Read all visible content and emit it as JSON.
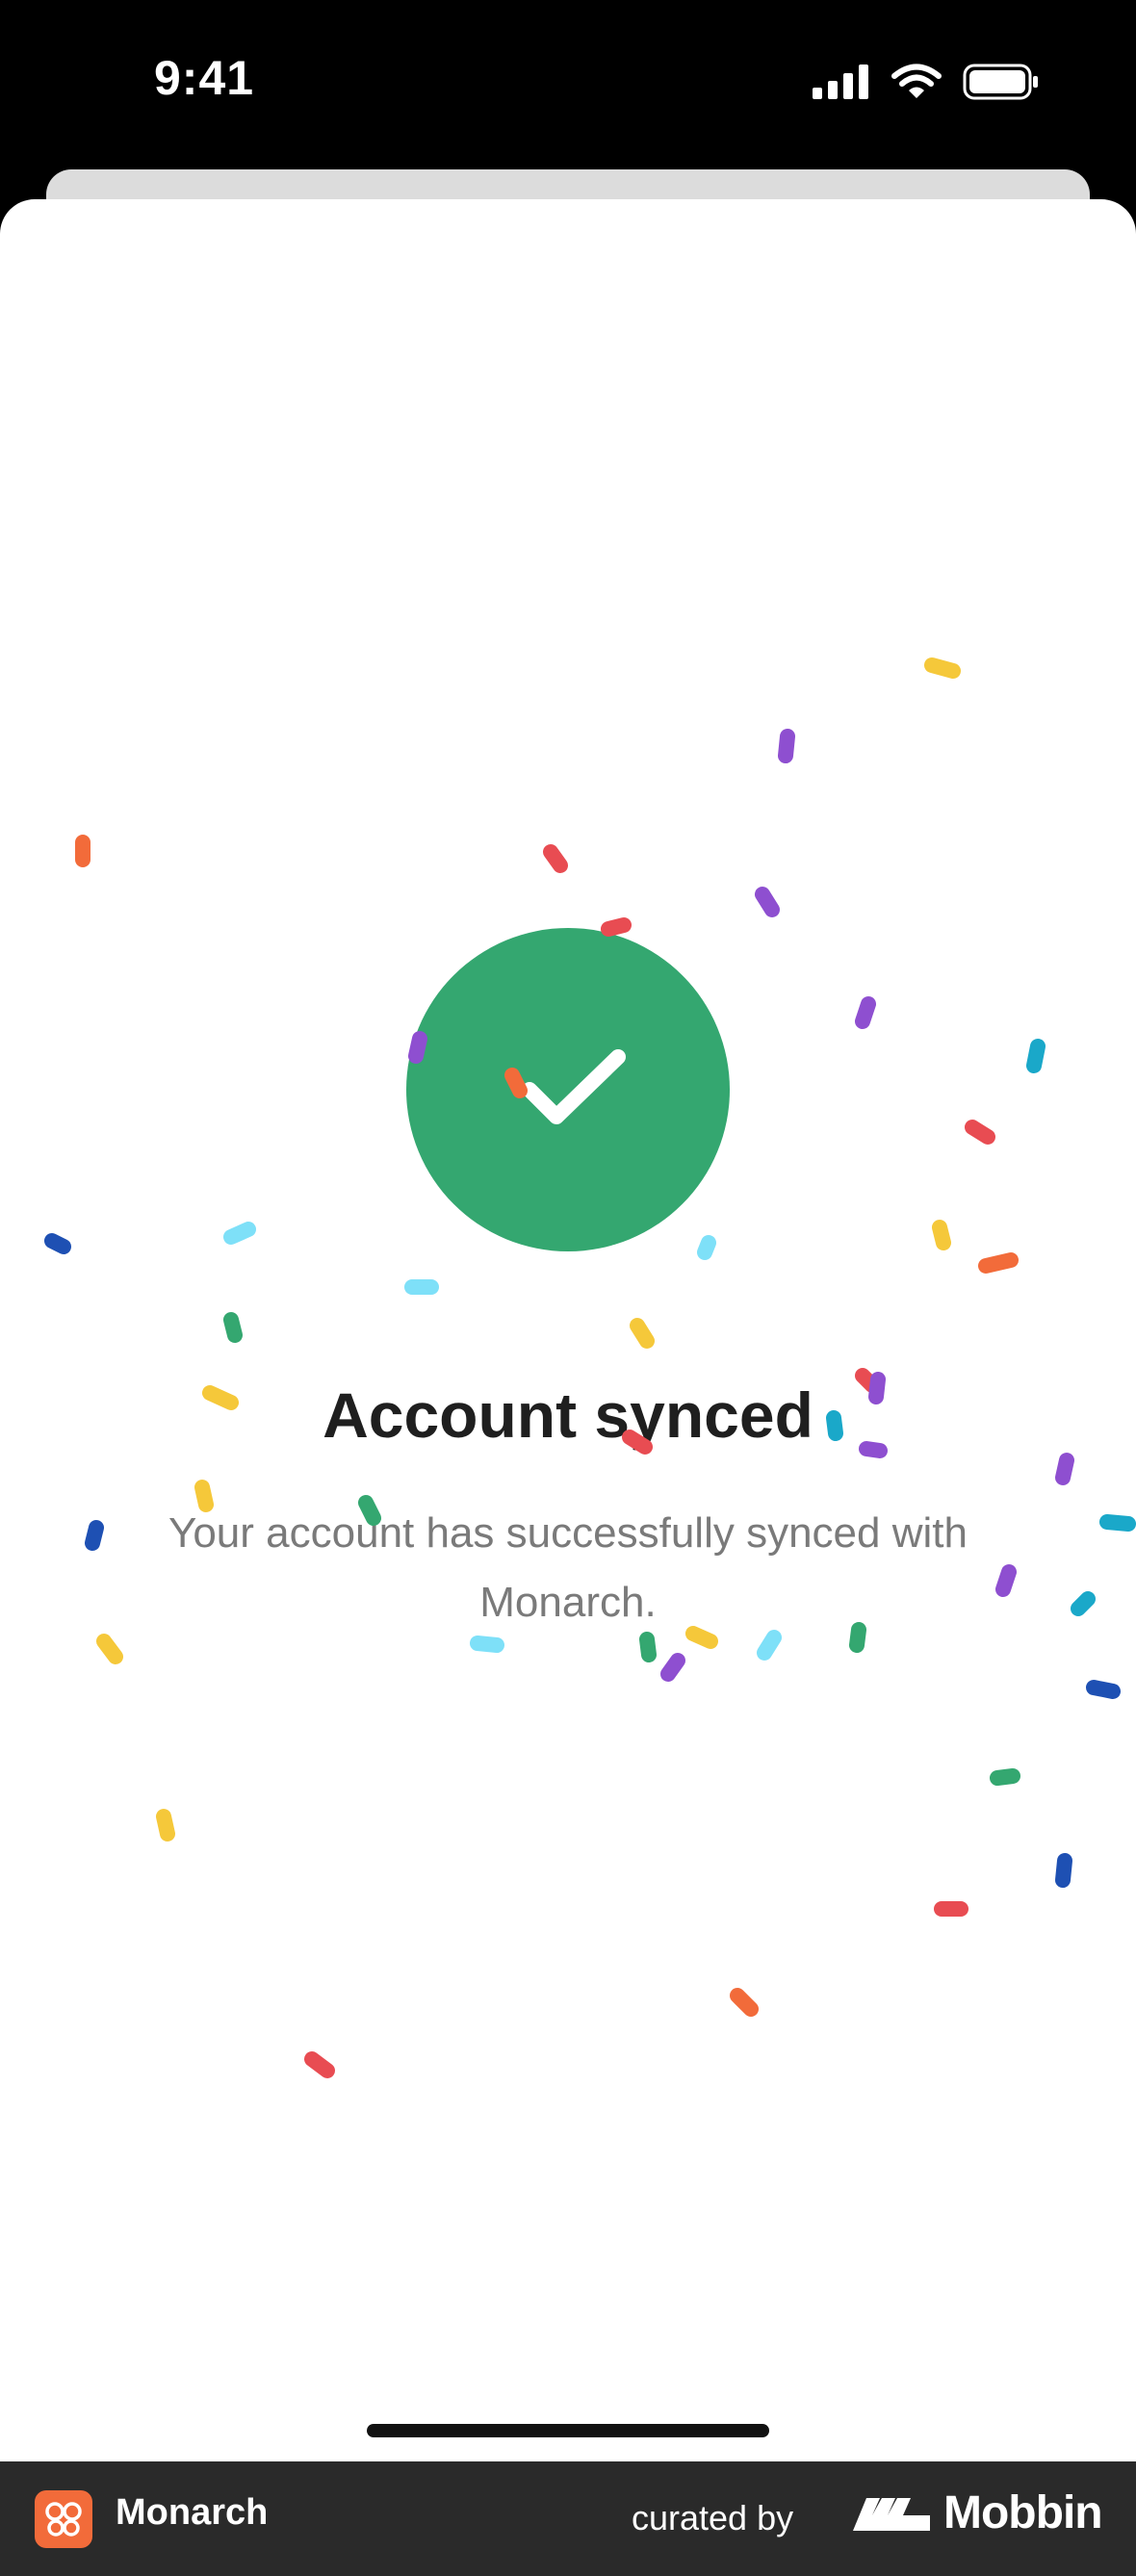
{
  "status_bar": {
    "time": "9:41",
    "icons": [
      "cellular-signal-icon",
      "wifi-icon",
      "battery-icon"
    ]
  },
  "success": {
    "icon": "checkmark-icon",
    "title": "Account synced",
    "message": "Your account has successfully synced with Monarch.",
    "accent_color": "#34a770"
  },
  "confetti": {
    "icon": "confetti",
    "colors": [
      "#f5c83a",
      "#8e4fd0",
      "#f26b3a",
      "#e84c52",
      "#34a770",
      "#1e50b3",
      "#7ee0f8",
      "#1aa8c9"
    ]
  },
  "footer": {
    "app_name": "Monarch",
    "curated_by": "curated by",
    "brand": "Mobbin"
  }
}
